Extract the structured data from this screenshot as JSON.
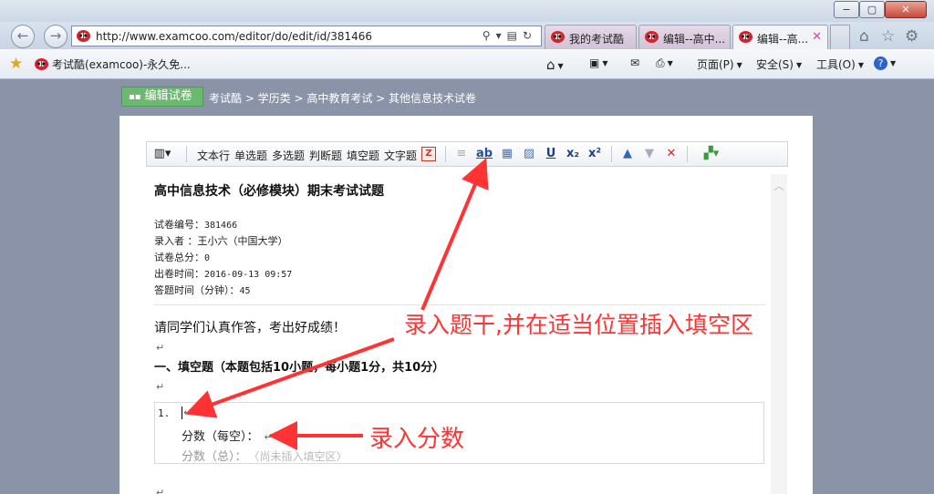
{
  "window": {
    "minimize": "−",
    "maximize": "▢",
    "close": "✕"
  },
  "nav": {
    "back_icon": "back-arrow-icon",
    "forward_icon": "forward-arrow-icon"
  },
  "address": {
    "url": "http://www.examcoo.com/editor/do/edit/id/381466"
  },
  "tabs": [
    {
      "label": "我的考试酷"
    },
    {
      "label": "编辑--高中..."
    },
    {
      "label": "编辑--高..."
    }
  ],
  "favorites": {
    "item": "考试酷(examcoo)-永久免..."
  },
  "commands": {
    "page": "页面(P)",
    "safety": "安全(S)",
    "tools": "工具(O)"
  },
  "header": {
    "edit_button": "编辑试卷",
    "breadcrumb": "考试酷 > 学历类 > 高中教育考试 > 其他信息技术试卷"
  },
  "toolbar": {
    "items": [
      "文本行",
      "单选题",
      "多选题",
      "判断题",
      "填空题",
      "文字题"
    ],
    "ab": "ab",
    "u": "U",
    "sub": "x₂",
    "sup": "x²"
  },
  "paper": {
    "title": "高中信息技术（必修模块）期末考试试题",
    "meta": [
      {
        "label": "试卷编号：",
        "value": "381466"
      },
      {
        "label": "录入者  ：",
        "value": "王小六（中国大学）"
      },
      {
        "label": "试卷总分：",
        "value": "0"
      },
      {
        "label": "出卷时间：",
        "value": "2016-09-13 09:57"
      },
      {
        "label": "答题时间（分钟）：",
        "value": "45"
      }
    ],
    "intro": "请同学们认真作答，考出好成绩！",
    "section": "一、填空题（本题包括10小题，每小题1分，共10分）",
    "return_mark": "↵"
  },
  "question": {
    "number": "1.",
    "score_each": "分数（每空）：",
    "score_total": "分数（总）：",
    "placeholder": "〈尚未插入填空区〉"
  },
  "annotations": {
    "stem": "录入题干,并在适当位置插入填空区",
    "score": "录入分数"
  },
  "colors": {
    "annotation": "#ff3333",
    "edit_button": "#6cb86f",
    "page_bg": "#8a93a8"
  }
}
